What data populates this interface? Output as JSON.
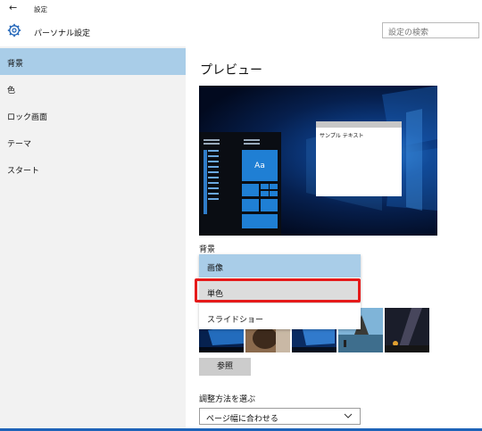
{
  "window": {
    "back_symbol": "←",
    "title": "設定"
  },
  "header": {
    "title": "パーソナル設定",
    "search_placeholder": "設定の検索"
  },
  "sidebar": {
    "items": [
      {
        "label": "背景",
        "active": true
      },
      {
        "label": "色",
        "active": false
      },
      {
        "label": "ロック画面",
        "active": false
      },
      {
        "label": "テーマ",
        "active": false
      },
      {
        "label": "スタート",
        "active": false
      }
    ]
  },
  "main": {
    "preview_heading": "プレビュー",
    "preview_sample_text": "サンプル テキスト",
    "preview_tile_text": "Aa",
    "background_label": "背景",
    "background_options": [
      {
        "label": "画像",
        "state": "selected"
      },
      {
        "label": "単色",
        "state": "hover"
      },
      {
        "label": "スライドショー",
        "state": "normal"
      }
    ],
    "browse_button": "参照",
    "fit_label": "調整方法を選ぶ",
    "fit_value": "ページ幅に合わせる"
  },
  "colors": {
    "accent": "#1e63b8",
    "selection": "#a9cde8",
    "highlight_box": "#e51a1a"
  }
}
